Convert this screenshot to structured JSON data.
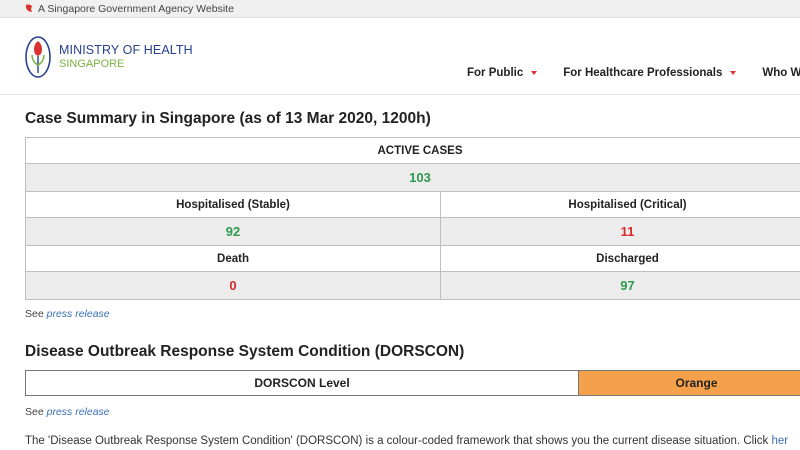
{
  "gov_banner": {
    "text": "A Singapore Government Agency Website",
    "icon": "lion-head-icon"
  },
  "logo": {
    "line1": "MINISTRY OF HEALTH",
    "line2": "SINGAPORE",
    "icon": "moh-logo-icon"
  },
  "nav": [
    {
      "label": "For Public"
    },
    {
      "label": "For Healthcare Professionals"
    },
    {
      "label": "Who We Are"
    }
  ],
  "case_summary": {
    "title": "Case Summary in Singapore (as of 13 Mar 2020, 1200h)",
    "active_label": "ACTIVE CASES",
    "active_value": "103",
    "hosp_stable_label": "Hospitalised (Stable)",
    "hosp_stable_value": "92",
    "hosp_critical_label": "Hospitalised (Critical)",
    "hosp_critical_value": "11",
    "death_label": "Death",
    "death_value": "0",
    "discharged_label": "Discharged",
    "discharged_value": "97"
  },
  "see_press_1": {
    "prefix": "See",
    "link": "press release"
  },
  "dorscon": {
    "title": "Disease Outbreak Response System Condition (DORSCON)",
    "level_label": "DORSCON Level",
    "level_value": "Orange",
    "level_color": "#f5a04a"
  },
  "see_press_2": {
    "prefix": "See",
    "link": "press release"
  },
  "description": {
    "text": "The 'Disease Outbreak Response System Condition' (DORSCON) is a colour-coded framework that shows you the current disease situation.  Click ",
    "link": "her"
  },
  "colors": {
    "green": "#2e9a4f",
    "red": "#d62a2a",
    "nav_caret": "#d9322f",
    "brand_blue": "#26418f",
    "brand_green": "#7cb342"
  }
}
